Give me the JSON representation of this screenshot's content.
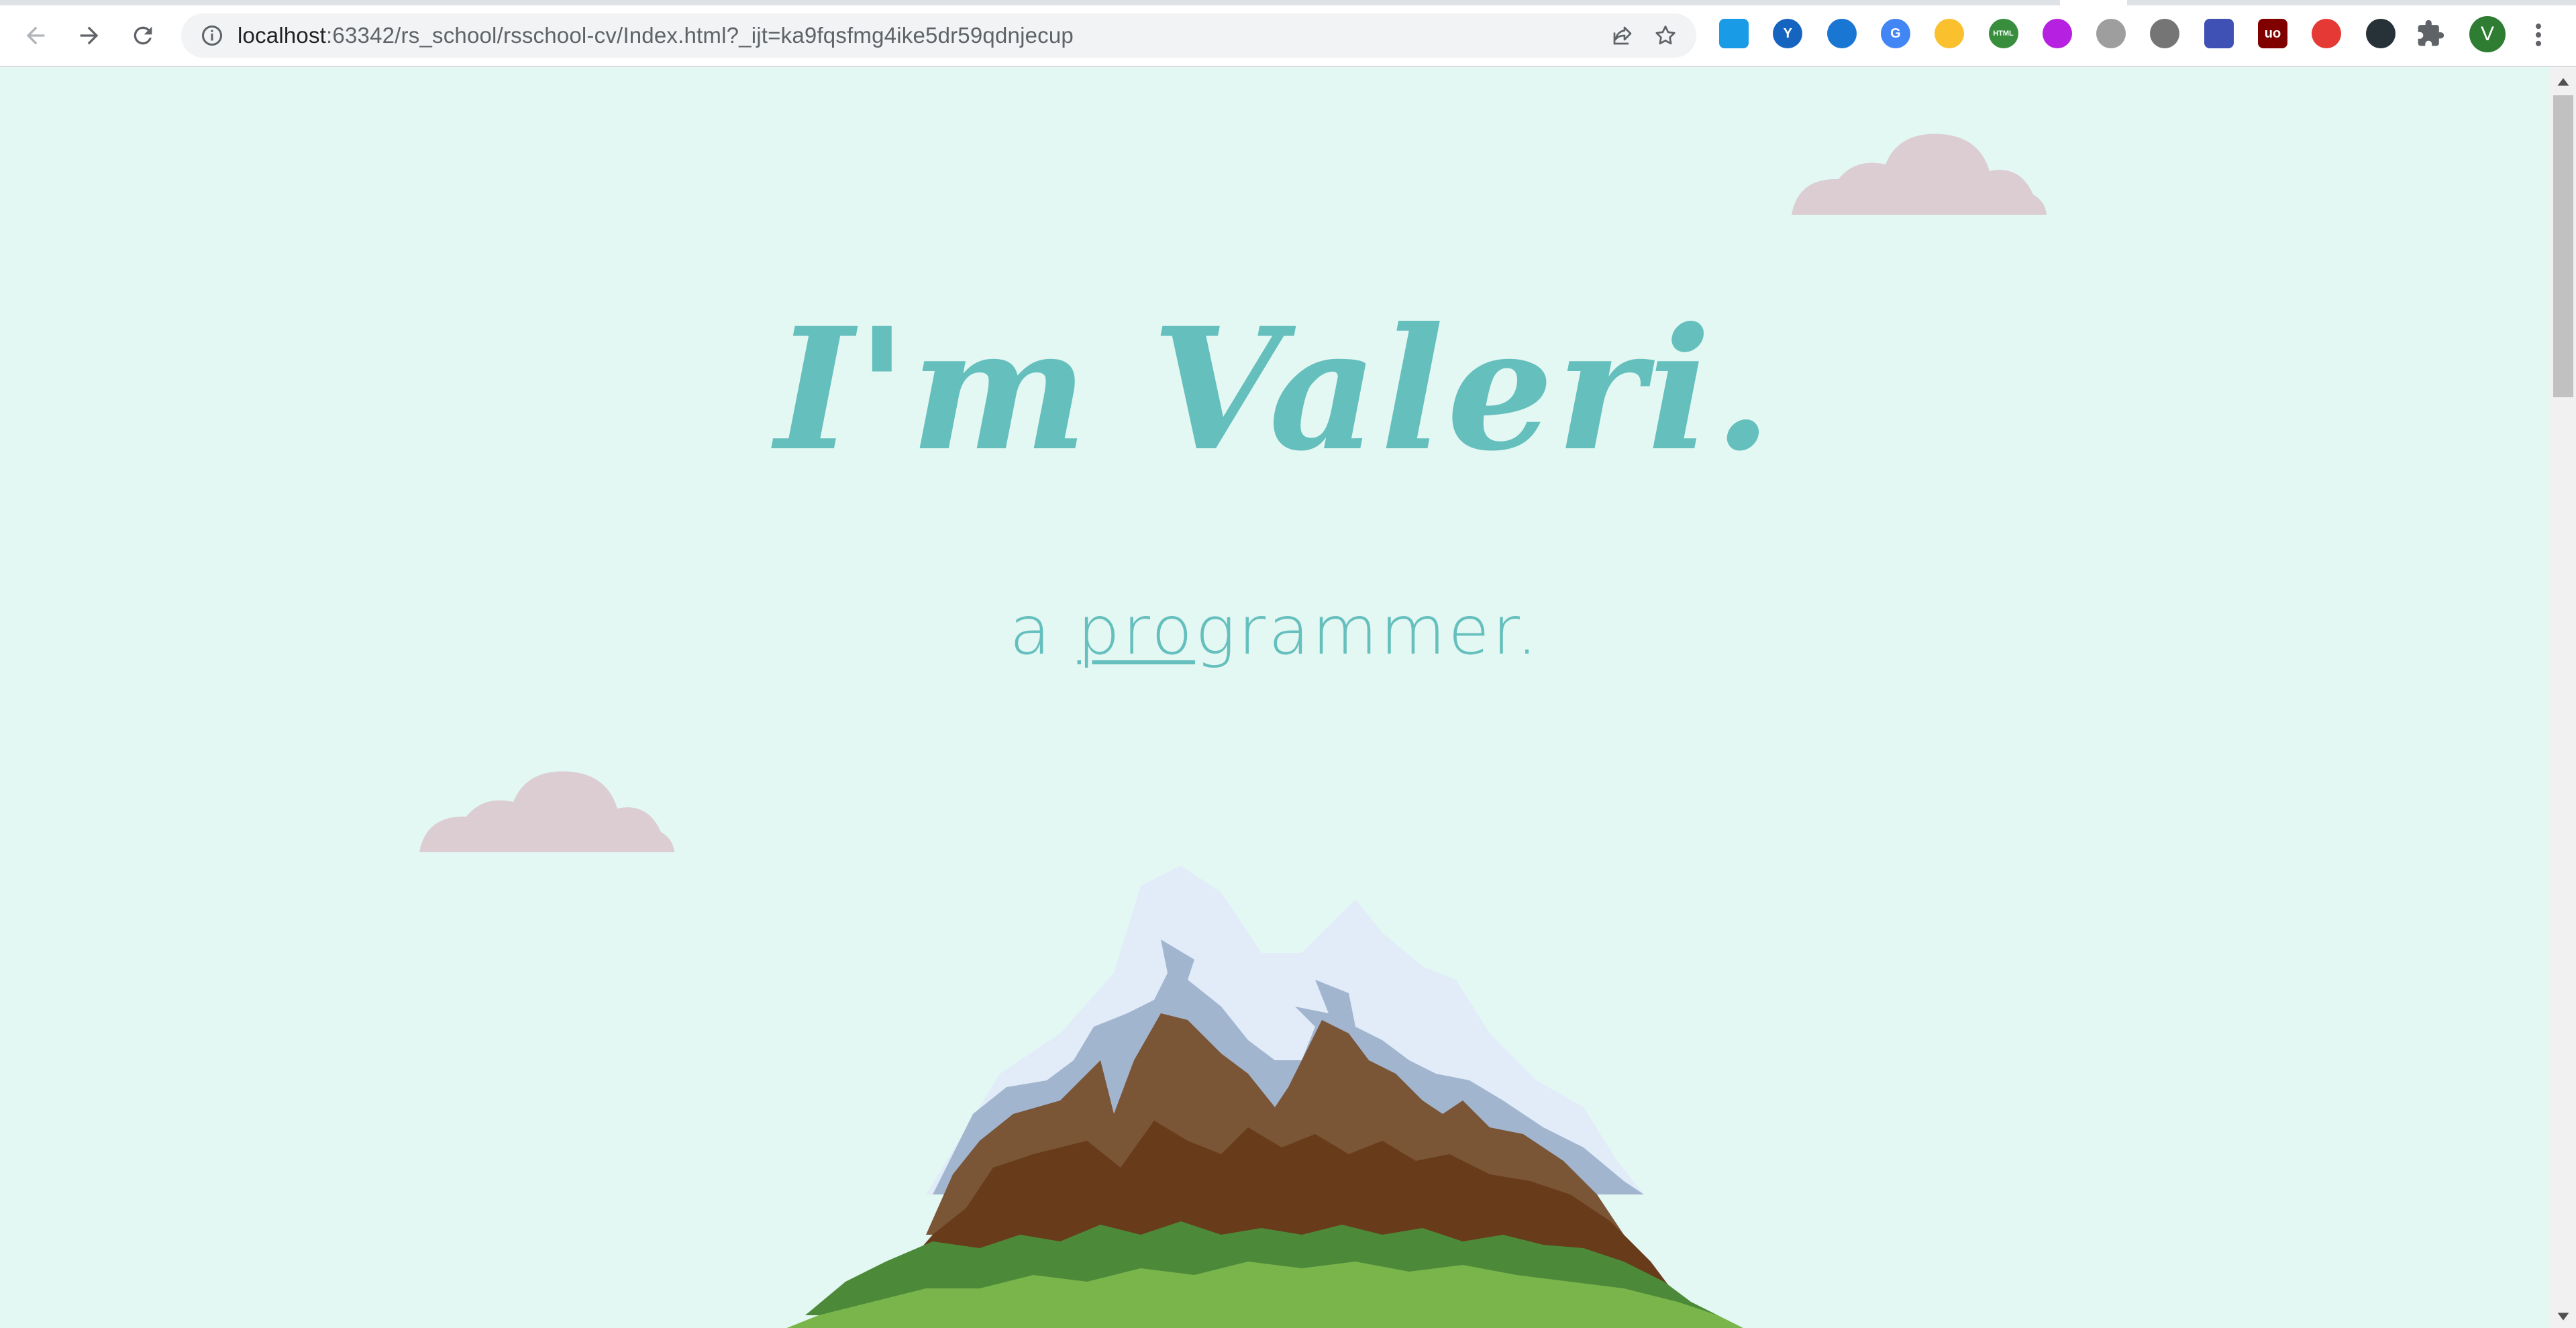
{
  "browser": {
    "url_host": "localhost",
    "url_rest": ":63342/rs_school/rsschool-cv/Index.html?_ijt=ka9fqsfmg4ike5dr59qdnjecup",
    "profile_initial": "V",
    "extensions": [
      {
        "name": "extension-1",
        "color": "#1a9be6",
        "glyph": ""
      },
      {
        "name": "extension-2",
        "color": "#1565c0",
        "glyph": "Y"
      },
      {
        "name": "extension-3",
        "color": "#1976d2",
        "glyph": ""
      },
      {
        "name": "google-translate-extension",
        "color": "#4285f4",
        "glyph": "G"
      },
      {
        "name": "extension-5",
        "color": "#fbc02d",
        "glyph": ""
      },
      {
        "name": "html-extension",
        "color": "#388e3c",
        "glyph": "HTML"
      },
      {
        "name": "extension-7",
        "color": "#b620e0",
        "glyph": ""
      },
      {
        "name": "extension-8",
        "color": "#9e9e9e",
        "glyph": ""
      },
      {
        "name": "extension-9",
        "color": "#757575",
        "glyph": ""
      },
      {
        "name": "extension-10",
        "color": "#3f51b5",
        "glyph": ""
      },
      {
        "name": "ublock-extension",
        "color": "#800000",
        "glyph": "uo"
      },
      {
        "name": "extension-12",
        "color": "#e53935",
        "glyph": ""
      },
      {
        "name": "extension-13",
        "color": "#263238",
        "glyph": ""
      }
    ]
  },
  "hero": {
    "title": "I'm Valeri.",
    "sub_prefix": "a ",
    "sub_link": "pro",
    "sub_rest": "grammer."
  },
  "colors": {
    "background": "#e3f7f3",
    "accent": "#64bfbd",
    "cloud": "#dbcdd2"
  }
}
